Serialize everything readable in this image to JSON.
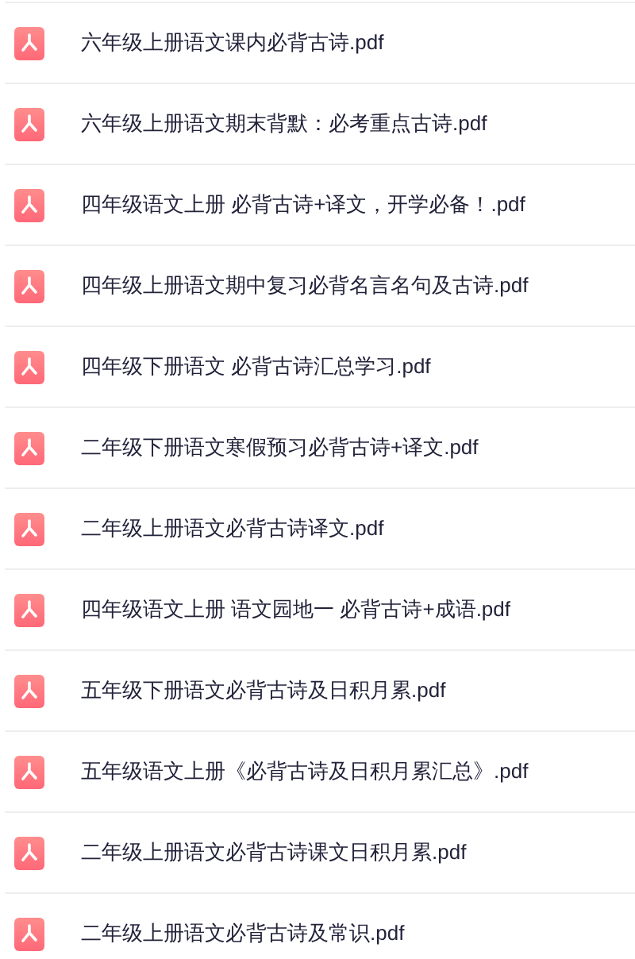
{
  "files": [
    {
      "name": "六年级上册语文课内必背古诗.pdf"
    },
    {
      "name": "六年级上册语文期末背默：必考重点古诗.pdf"
    },
    {
      "name": "四年级语文上册 必背古诗+译文，开学必备！.pdf"
    },
    {
      "name": "四年级上册语文期中复习必背名言名句及古诗.pdf"
    },
    {
      "name": "四年级下册语文 必背古诗汇总学习.pdf"
    },
    {
      "name": "二年级下册语文寒假预习必背古诗+译文.pdf"
    },
    {
      "name": "二年级上册语文必背古诗译文.pdf"
    },
    {
      "name": "四年级语文上册 语文园地一 必背古诗+成语.pdf"
    },
    {
      "name": "五年级下册语文必背古诗及日积月累.pdf"
    },
    {
      "name": "五年级语文上册《必背古诗及日积月累汇总》.pdf"
    },
    {
      "name": "二年级上册语文必背古诗课文日积月累.pdf"
    },
    {
      "name": "二年级上册语文必背古诗及常识.pdf"
    }
  ]
}
